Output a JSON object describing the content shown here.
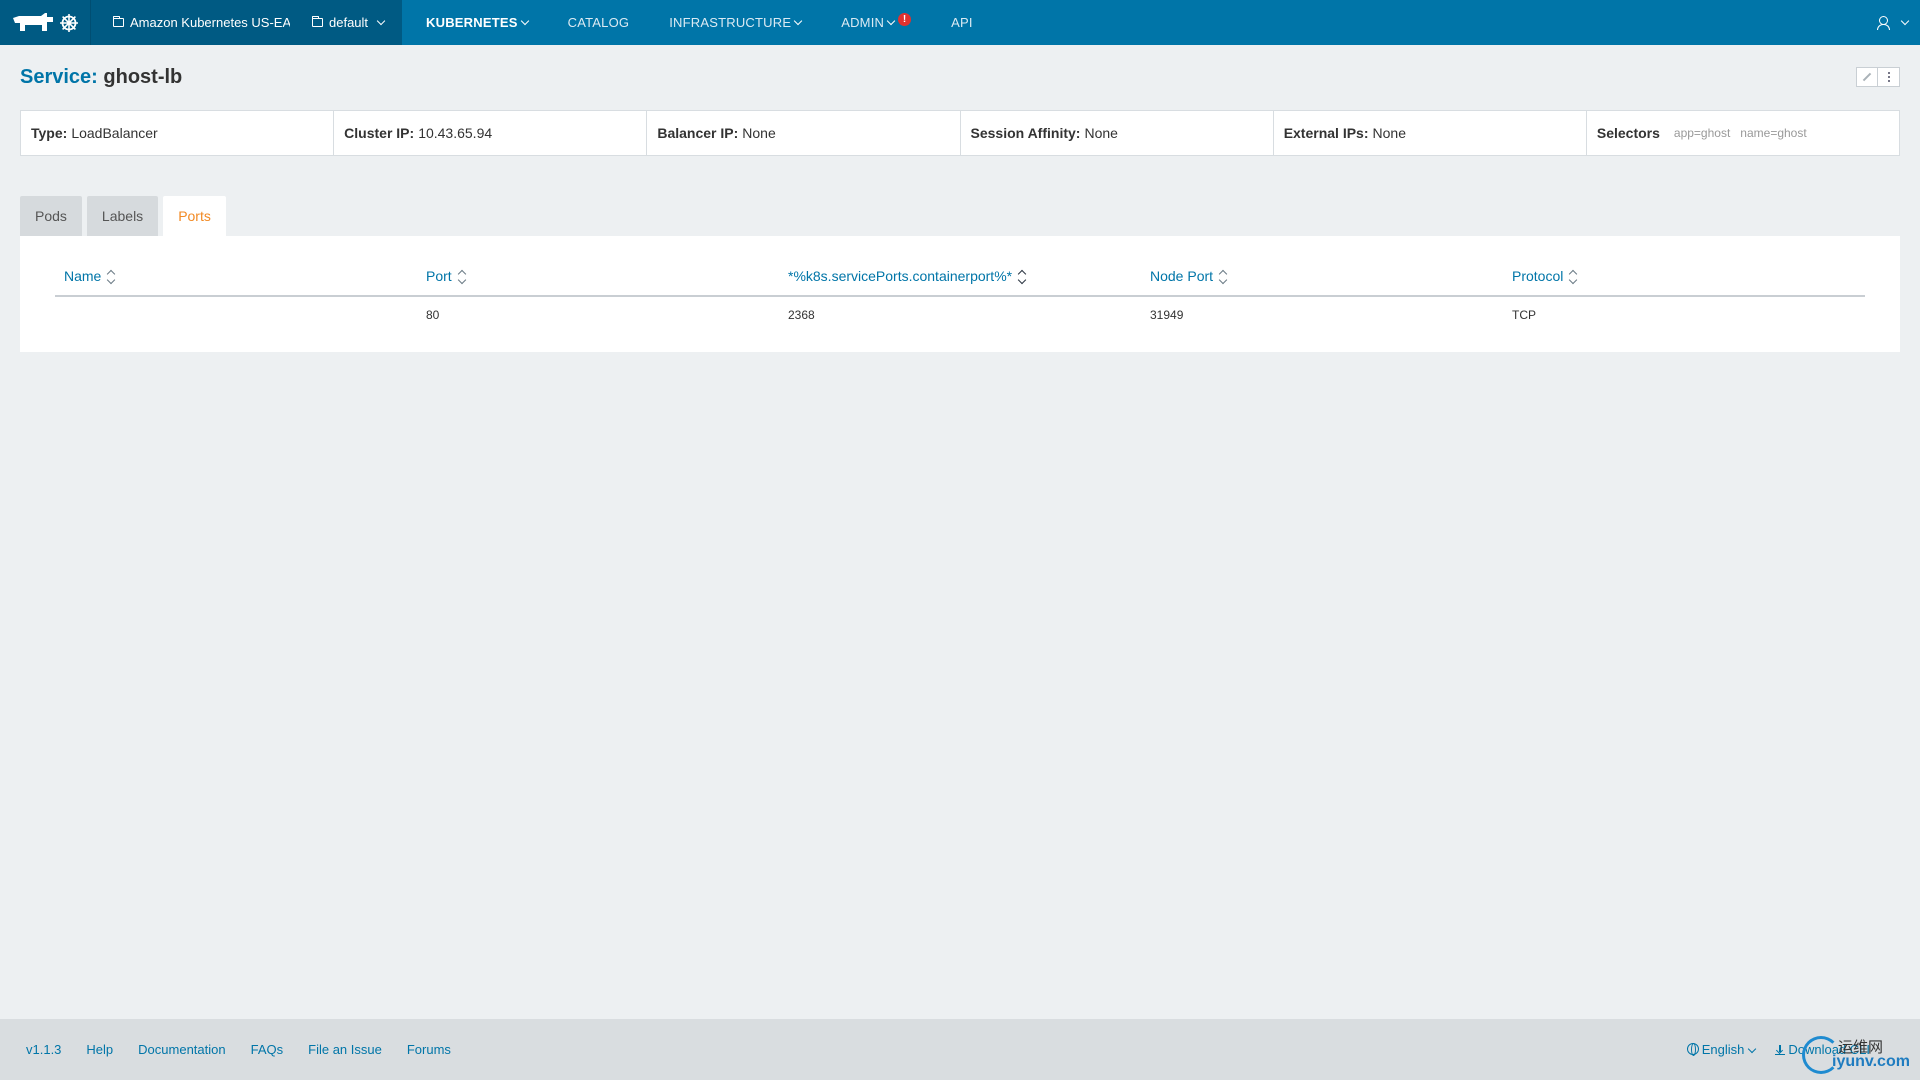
{
  "nav": {
    "environment": "Amazon Kubernetes US-EAST",
    "stack": "default",
    "links": [
      {
        "label": "KUBERNETES",
        "active": true,
        "dropdown": true
      },
      {
        "label": "CATALOG",
        "active": false,
        "dropdown": false
      },
      {
        "label": "INFRASTRUCTURE",
        "active": false,
        "dropdown": true
      },
      {
        "label": "ADMIN",
        "active": false,
        "dropdown": true,
        "alert": "!"
      },
      {
        "label": "API",
        "active": false,
        "dropdown": false
      }
    ]
  },
  "page": {
    "title_label": "Service:",
    "title_value": "ghost-lb"
  },
  "info": {
    "type_label": "Type:",
    "type_value": "LoadBalancer",
    "cluster_ip_label": "Cluster IP:",
    "cluster_ip_value": "10.43.65.94",
    "balancer_ip_label": "Balancer IP:",
    "balancer_ip_value": "None",
    "session_affinity_label": "Session Affinity:",
    "session_affinity_value": "None",
    "external_ips_label": "External IPs:",
    "external_ips_value": "None",
    "selectors_label": "Selectors",
    "selectors": [
      "app=ghost",
      "name=ghost"
    ]
  },
  "tabs": [
    {
      "label": "Pods",
      "active": false
    },
    {
      "label": "Labels",
      "active": false
    },
    {
      "label": "Ports",
      "active": true
    }
  ],
  "ports_table": {
    "columns": [
      "Name",
      "Port",
      "*%k8s.servicePorts.containerport%*",
      "Node Port",
      "Protocol"
    ],
    "rows": [
      [
        "",
        "80",
        "2368",
        "31949",
        "TCP"
      ]
    ]
  },
  "footer": {
    "version": "v1.1.3",
    "links": [
      "Help",
      "Documentation",
      "FAQs",
      "File an Issue",
      "Forums"
    ],
    "language": "English",
    "download": "Download CLI"
  },
  "watermark": {
    "cn": "运维网",
    "en": "iyunv.com"
  },
  "colors": {
    "nav_bg": "#0075a8",
    "nav_dark": "#005a83",
    "accent": "#0075a8",
    "active_tab": "#f28a24",
    "alert": "#e0322f"
  }
}
